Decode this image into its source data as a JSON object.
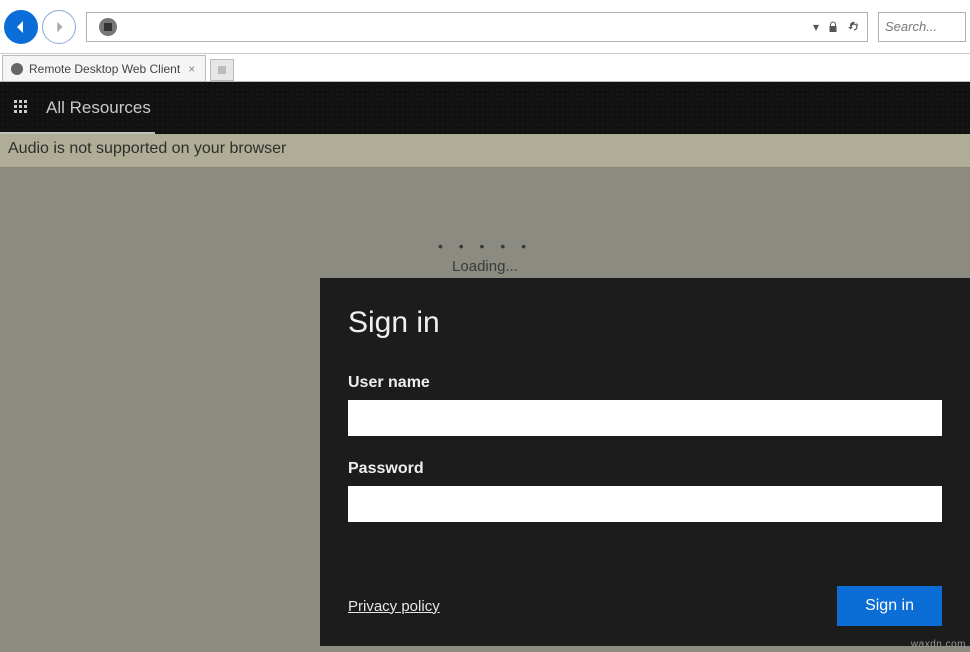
{
  "browser": {
    "search_placeholder": "Search...",
    "tab_title": "Remote Desktop Web Client",
    "address_dropdown_symbol": "▾"
  },
  "app_toolbar": {
    "all_resources": "All Resources"
  },
  "warning": {
    "text": "Audio is not supported on your browser"
  },
  "loading": {
    "dots": "• • • • •",
    "text": "Loading..."
  },
  "signin": {
    "title": "Sign in",
    "username_label": "User name",
    "username_value": "",
    "password_label": "Password",
    "password_value": "",
    "privacy": "Privacy policy",
    "button": "Sign in"
  },
  "watermark": "waxdn.com"
}
